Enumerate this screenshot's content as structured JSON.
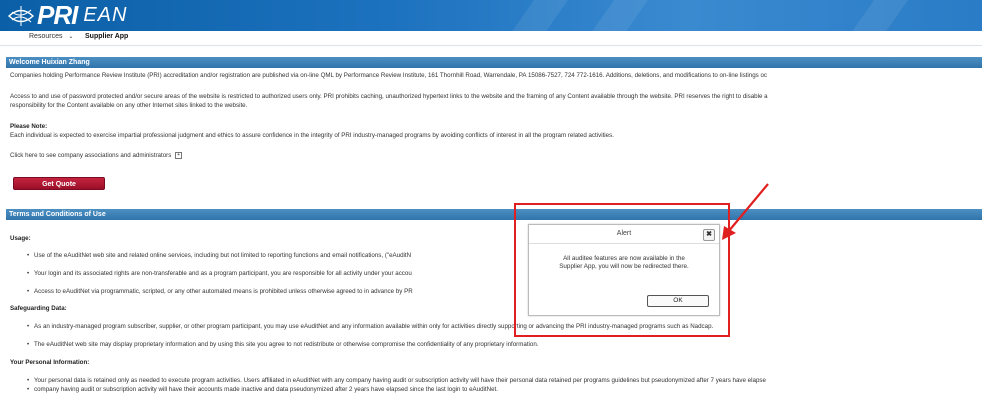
{
  "brand": {
    "logo_text": "PRI",
    "app_name": "EAN"
  },
  "nav": {
    "resources_label": "Resources",
    "supplier_app_label": "Supplier App"
  },
  "welcome": {
    "heading": "Welcome Huixian Zhang",
    "para1": "Companies holding Performance Review Institute (PRI) accreditation and/or registration are published via on-line QML by Performance Review Institute, 161 Thornhill Road, Warrendale, PA 15086-7527, 724 772-1616. Additions, deletions, and modifications to on-line listings oc",
    "para2_line1": "Access to and use of password protected and/or secure areas of the website is restricted to authorized users only. PRI prohibits caching, unauthorized hypertext links to the website and the framing of any Content available through the website. PRI reserves the right to disable a",
    "para2_line2": "responsibility for the Content available on any other Internet sites linked to the website.",
    "note_heading": "Please Note:",
    "note_text": "Each individual is expected to exercise impartial professional judgment and ethics to assure confidence in the integrity of PRI industry-managed programs by avoiding conflicts of interest in all the program related activities.",
    "associations_link": "Click here to see company associations and administrators",
    "quote_button": "Get Quote"
  },
  "terms": {
    "heading": "Terms and Conditions of Use",
    "usage_heading": "Usage:",
    "usage_items": [
      "Use of the eAuditNet web site and related online services, including but not limited to reporting functions and email notifications, (\"eAuditN",
      "Your login and its associated rights are non-transferable and as a program participant, you are responsible for all activity under your accou",
      "Access to eAuditNet via programmatic, scripted, or any other automated means is prohibited unless otherwise agreed to in advance by PR"
    ],
    "safeguarding_heading": "Safeguarding Data:",
    "safeguarding_items": [
      "As an industry-managed program subscriber, supplier, or other program participant, you may use eAuditNet and any information available within only for activities directly supporting or advancing the PRI industry-managed programs such as Nadcap.",
      "The eAuditNet web site may display proprietary information and by using this site you agree to not redistribute or otherwise compromise the confidentiality of any proprietary information."
    ],
    "personal_heading": "Your Personal Information:",
    "personal_line1": "Your personal data is retained only as needed to execute program activities. Users affiliated in eAuditNet with any company having audit or subscription activity will have their personal data retained per programs guidelines but pseudonymized after 7 years have elapse",
    "personal_line2": "company having audit or subscription activity will have their accounts made inactive and data pseudonymized after 2 years have elapsed since the last login to eAuditNet."
  },
  "alert": {
    "title": "Alert",
    "close_symbol": "✖",
    "message_line1": "All auditee features are now available in the",
    "message_line2": "Supplier App, you will now be redirected there.",
    "ok_label": "OK"
  },
  "colors": {
    "banner": "#1d72bf",
    "section_bar": "#3a7fb6",
    "quote_button": "#b01a34",
    "callout": "#e02020"
  }
}
